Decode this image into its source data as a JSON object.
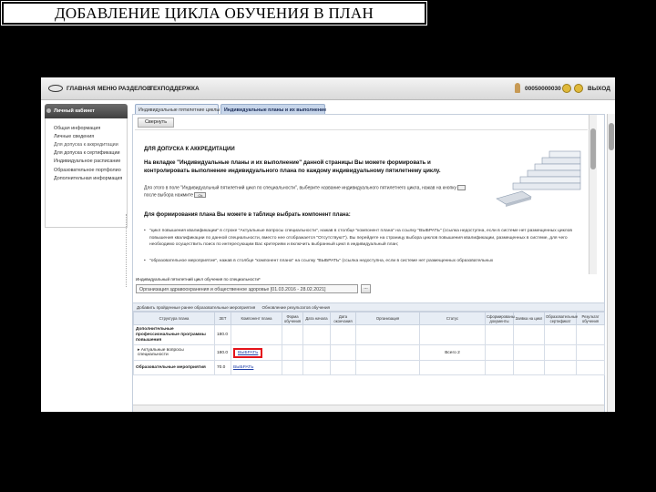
{
  "slide": {
    "title": "ДОБАВЛЕНИЕ ЦИКЛА ОБУЧЕНИЯ В ПЛАН"
  },
  "topbar": {
    "nav": [
      "ГЛАВНАЯ",
      "МЕНЮ РАЗДЕЛОВ",
      "ТЕХПОДДЕРЖКА"
    ],
    "user_id": "00050000030",
    "logout": "ВЫХОД"
  },
  "sidebar": {
    "title": "Личный кабинет",
    "items": [
      "Общая информация",
      "Личные сведения",
      "Для допуска к аккредитации",
      "Для допуска к сертификации",
      "Индивидуальное расписание",
      "Образовательное портфолио",
      "Дополнительная информация"
    ]
  },
  "tabs": [
    "Индивидуальные пятилетние циклы",
    "Индивидуальные планы и их выполнение"
  ],
  "content": {
    "collapse_label": "Свернуть",
    "heading": "ДЛЯ ДОПУСКА К АККРЕДИТАЦИИ",
    "intro_bold": "На вкладке \"Индивидуальные планы и их выполнение\" данной страницы Вы можете формировать и контролировать выполнение индивидуального плана по каждому индивидуальному пятилетнему циклу.",
    "intro_text_a": "Для этого в поле \"Индивидуальный пятилетний цикл по специальности\", выберите название индивидуального пятилетнего цикла, нажав на кнопку",
    "intro_text_b": "после выбора нажмите",
    "ok_label": "Ok",
    "subheading": "Для формирования плана Вы можете в таблице выбрать компонент плана:",
    "bullet1": "\"цикл повышения квалификации\" в строке \"Актуальные вопросы специальности\", нажав в столбце \"компонент плана\" на ссылку \"ВЫБРАТЬ\" (ссылка недоступна, если в системе нет размещенных циклов повышения квалификации по данной специальности, вместо нее отображается \"Отсутствуют\"). Вы перейдете на страницу выбора циклов повышения квалификации, размещенных в системе, для чего необходимо осуществить поиск по интересующим Вас критериям и включить выбранный цикл в индивидуальный план;",
    "bullet2": "\"образовательное мероприятие\", нажав в столбце \"компонент плана\" на ссылку \"ВЫБРАТЬ\" (ссылка недоступна, если в системе нет размещенных образовательных",
    "select_label": "Индивидуальный пятилетний цикл обучения по специальности*",
    "select_value": "Организация здравоохранения и общественное здоровье [01.03.2016 - 28.02.2021]",
    "dots_label": "...",
    "toolbar": [
      "Добавить пройденные ранее образовательные мероприятия",
      "Обновление результатов обучения"
    ]
  },
  "table": {
    "headers": [
      "Структура плана",
      "ЗЕТ",
      "Компонент плана",
      "Форма обучения",
      "Дата начала",
      "Дата окончания",
      "Организация",
      "Статус",
      "Сформированы документы",
      "Заявка на цикл",
      "Образовательные сертификат",
      "Результат обучения"
    ],
    "rows": [
      {
        "structure": "Дополнительные профессиональные программы повышения",
        "zet": "180.0",
        "component": "",
        "status": ""
      },
      {
        "structure": "▸ Актуальные вопросы специальности",
        "zet": "180.0",
        "component": "ВЫБРАТЬ",
        "status": "Всего 2"
      },
      {
        "structure": "Образовательные мероприятия",
        "zet": "70.0",
        "component": "ВЫБРАТЬ",
        "status": ""
      }
    ]
  },
  "colors": {
    "highlight": "#e4141b",
    "link": "#1f3fa8",
    "active_tab": "#c6d5ea"
  }
}
